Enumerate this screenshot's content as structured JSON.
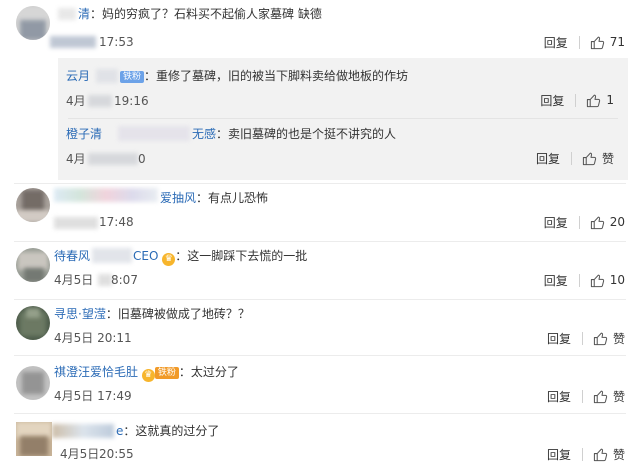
{
  "comments": [
    {
      "user": "清",
      "text": "妈的穷疯了？石料买不起偷人家墓碑 缺德",
      "time": "17:53",
      "reply_label": "回复",
      "likes": "71",
      "avatar_colors": [
        "#d8d8d8",
        "#a9b4c2",
        "#6e7682"
      ],
      "sub_replies": [
        {
          "user": "云月",
          "badge": "铁粉",
          "text": "重修了墓碑，旧的被当下脚料卖给做地板的作坊",
          "time_left": "4月",
          "time_right": "19:16",
          "reply_label": "回复",
          "likes": "1"
        },
        {
          "user": "橙子清",
          "user_suffix": "无感",
          "text": "卖旧墓碑的也是个挺不讲究的人",
          "time_left": "4月",
          "time_right": "0",
          "reply_label": "回复",
          "likes": "赞"
        }
      ]
    },
    {
      "user": "爱抽风",
      "text": "有点儿恐怖",
      "time": "17:48",
      "reply_label": "回复",
      "likes": "20",
      "avatar_colors": [
        "#b6b0ab",
        "#7e7672",
        "#dcd6d0"
      ]
    },
    {
      "user": "待春风",
      "user_suffix": "CEO",
      "text": "这一脚踩下去慌的一批",
      "time_left": "4月5日",
      "time_right": "8:07",
      "reply_label": "回复",
      "likes": "10",
      "avatar_colors": [
        "#9a9f97",
        "#cfcac4",
        "#70756f"
      ]
    },
    {
      "user": "寻思·望滢",
      "text": "旧墓碑被做成了地砖？？",
      "time": "4月5日 20:11",
      "reply_label": "回复",
      "likes": "赞",
      "avatar_colors": [
        "#4f5e4c",
        "#9aa58f",
        "#30382f"
      ]
    },
    {
      "user": "祺澄汪爱恰毛肚",
      "badge": "铁粉",
      "text": "太过分了",
      "time": "4月5日 17:49",
      "reply_label": "回复",
      "likes": "赞",
      "avatar_colors": [
        "#c2c2c2",
        "#8f8f8f",
        "#e0e0e0"
      ]
    },
    {
      "user": "e",
      "text": "这就真的过分了",
      "time_left": "4月5日",
      "time_right": "20:55",
      "reply_label": "回复",
      "likes": "赞",
      "avatar_colors": [
        "#c9b59a",
        "#8e7a64",
        "#e6d9c4"
      ]
    }
  ],
  "colors": {
    "username": "#2b6bb6",
    "fan_badge": "#f19a28",
    "sub_bg": "#f2f2f2"
  },
  "icons": {
    "like": "thumbs-up-icon"
  }
}
